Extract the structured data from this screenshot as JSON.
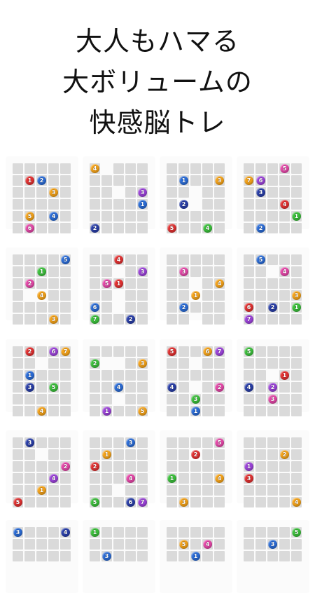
{
  "headline": {
    "lines": [
      "大人もハマる",
      "大ボリュームの",
      "快感脳トレ"
    ]
  },
  "colors": {
    "1": "#39b54a",
    "2": "#2e6fd0",
    "3": "#f2b01e",
    "4": "#8e4ad6",
    "5": "#f07a2a",
    "6": "#e0459e",
    "7": "#f08a1e",
    "red": "#e13131",
    "blue": "#2b6cd6",
    "green": "#3bbf3b",
    "purple": "#9b43d8",
    "orange": "#f3a21a",
    "pink": "#e447a8",
    "yellow": "#f4c21a",
    "navy": "#2a3fa8"
  },
  "puzzles": [
    {
      "dots": [
        {
          "n": "1",
          "c": "red"
        },
        {
          "n": "2",
          "c": "blue"
        },
        {
          "n": "3",
          "c": "orange"
        },
        {
          "n": "5",
          "c": "orange"
        },
        {
          "n": "4",
          "c": "blue"
        },
        {
          "n": "6",
          "c": "pink"
        }
      ]
    },
    {
      "dots": [
        {
          "n": "4",
          "c": "orange"
        },
        {
          "n": "3",
          "c": "purple"
        },
        {
          "n": "1",
          "c": "blue"
        },
        {
          "n": "2",
          "c": "navy"
        }
      ]
    },
    {
      "dots": [
        {
          "n": "1",
          "c": "blue"
        },
        {
          "n": "3",
          "c": "orange"
        },
        {
          "n": "2",
          "c": "navy"
        },
        {
          "n": "5",
          "c": "red"
        },
        {
          "n": "4",
          "c": "green"
        }
      ]
    },
    {
      "dots": [
        {
          "n": "5",
          "c": "pink"
        },
        {
          "n": "7",
          "c": "orange"
        },
        {
          "n": "6",
          "c": "purple"
        },
        {
          "n": "3",
          "c": "navy"
        },
        {
          "n": "4",
          "c": "red"
        },
        {
          "n": "1",
          "c": "green"
        },
        {
          "n": "2",
          "c": "blue"
        }
      ]
    },
    {
      "dots": [
        {
          "n": "5",
          "c": "blue"
        },
        {
          "n": "1",
          "c": "green"
        },
        {
          "n": "2",
          "c": "pink"
        },
        {
          "n": "4",
          "c": "orange"
        },
        {
          "n": "3",
          "c": "orange"
        }
      ]
    },
    {
      "dots": [
        {
          "n": "4",
          "c": "red"
        },
        {
          "n": "3",
          "c": "purple"
        },
        {
          "n": "5",
          "c": "pink"
        },
        {
          "n": "1",
          "c": "red"
        },
        {
          "n": "6",
          "c": "blue"
        },
        {
          "n": "7",
          "c": "green"
        },
        {
          "n": "2",
          "c": "navy"
        }
      ]
    },
    {
      "dots": [
        {
          "n": "3",
          "c": "pink"
        },
        {
          "n": "4",
          "c": "orange"
        },
        {
          "n": "1",
          "c": "orange"
        },
        {
          "n": "2",
          "c": "blue"
        }
      ]
    },
    {
      "dots": [
        {
          "n": "5",
          "c": "blue"
        },
        {
          "n": "4",
          "c": "pink"
        },
        {
          "n": "3",
          "c": "orange"
        },
        {
          "n": "6",
          "c": "red"
        },
        {
          "n": "2",
          "c": "navy"
        },
        {
          "n": "1",
          "c": "green"
        },
        {
          "n": "7",
          "c": "purple"
        }
      ]
    },
    {
      "dots": [
        {
          "n": "2",
          "c": "red"
        },
        {
          "n": "6",
          "c": "purple"
        },
        {
          "n": "7",
          "c": "orange"
        },
        {
          "n": "1",
          "c": "blue"
        },
        {
          "n": "3",
          "c": "navy"
        },
        {
          "n": "5",
          "c": "green"
        },
        {
          "n": "4",
          "c": "orange"
        }
      ]
    },
    {
      "dots": [
        {
          "n": "2",
          "c": "green"
        },
        {
          "n": "3",
          "c": "orange"
        },
        {
          "n": "4",
          "c": "blue"
        },
        {
          "n": "1",
          "c": "purple"
        },
        {
          "n": "5",
          "c": "orange"
        }
      ]
    },
    {
      "dots": [
        {
          "n": "5",
          "c": "red"
        },
        {
          "n": "6",
          "c": "orange"
        },
        {
          "n": "7",
          "c": "purple"
        },
        {
          "n": "4",
          "c": "navy"
        },
        {
          "n": "2",
          "c": "pink"
        },
        {
          "n": "3",
          "c": "green"
        },
        {
          "n": "1",
          "c": "blue"
        }
      ]
    },
    {
      "dots": [
        {
          "n": "5",
          "c": "green"
        },
        {
          "n": "1",
          "c": "red"
        },
        {
          "n": "4",
          "c": "navy"
        },
        {
          "n": "2",
          "c": "purple"
        },
        {
          "n": "3",
          "c": "pink"
        }
      ]
    },
    {
      "dots": [
        {
          "n": "3",
          "c": "navy"
        },
        {
          "n": "2",
          "c": "pink"
        },
        {
          "n": "4",
          "c": "purple"
        },
        {
          "n": "1",
          "c": "orange"
        },
        {
          "n": "5",
          "c": "red"
        }
      ]
    },
    {
      "dots": [
        {
          "n": "3",
          "c": "blue"
        },
        {
          "n": "1",
          "c": "orange"
        },
        {
          "n": "2",
          "c": "red"
        },
        {
          "n": "4",
          "c": "pink"
        },
        {
          "n": "5",
          "c": "green"
        },
        {
          "n": "6",
          "c": "navy"
        },
        {
          "n": "7",
          "c": "purple"
        }
      ]
    },
    {
      "dots": [
        {
          "n": "5",
          "c": "pink"
        },
        {
          "n": "2",
          "c": "red"
        },
        {
          "n": "1",
          "c": "green"
        },
        {
          "n": "4",
          "c": "orange"
        },
        {
          "n": "3",
          "c": "orange"
        }
      ]
    },
    {
      "dots": [
        {
          "n": "2",
          "c": "orange"
        },
        {
          "n": "1",
          "c": "purple"
        },
        {
          "n": "3",
          "c": "red"
        },
        {
          "n": "4",
          "c": "orange"
        }
      ]
    },
    {
      "dots": [
        {
          "n": "3",
          "c": "blue"
        },
        {
          "n": "4",
          "c": "navy"
        }
      ]
    },
    {
      "dots": [
        {
          "n": "1",
          "c": "green"
        },
        {
          "n": "3",
          "c": "blue"
        }
      ]
    },
    {
      "dots": [
        {
          "n": "5",
          "c": "orange"
        },
        {
          "n": "4",
          "c": "pink"
        },
        {
          "n": "1",
          "c": "blue"
        }
      ]
    },
    {
      "dots": [
        {
          "n": "5",
          "c": "green"
        },
        {
          "n": "3",
          "c": "blue"
        }
      ]
    }
  ]
}
